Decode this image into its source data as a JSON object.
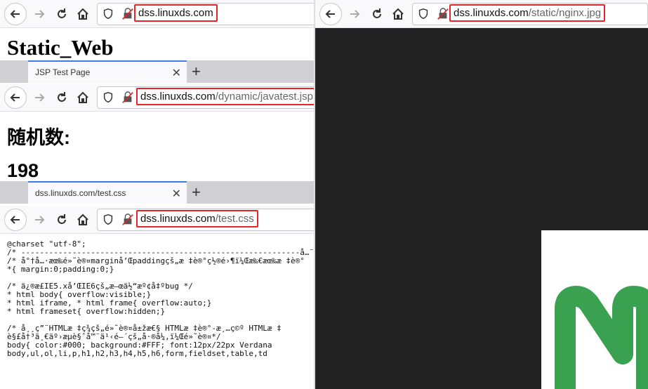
{
  "windows": {
    "static_html": {
      "url_host": "dss.linuxds.com",
      "url_path": "",
      "heading": "Static_Web"
    },
    "jsp": {
      "tab_title": "JSP Test Page",
      "url_host": "dss.linuxds.com",
      "url_path": "/dynamic/javatest.jsp",
      "label": "随机数:",
      "value": "198"
    },
    "css": {
      "tab_title": "dss.linuxds.com/test.css",
      "url_host": "dss.linuxds.com",
      "url_path": "/test.css",
      "lines": [
        "@charset \"utf-8\";",
        "/* ------------------------------------------------------------å…¨å±€é‡ç½®---------",
        "/* å°†å…·æœ‰é»˜è®¤marginå’Œpaddingçš„æ ‡è®°ç½®é›¶ï¼Œæ‰€æœ‰æ ‡è®°",
        "*{ margin:0;padding:0;}",
        "",
        "/* ä¿®æ­£IE5.xå’ŒIE6çš„æ–œä½“æº¢å‡ºbug */",
        "* html body{ overflow:visible;}",
        "* html iframe, * html frame{ overflow:auto;}",
        "* html frameset{ overflow:hidden;}",
        "",
        "/* å¸¸ç”¨HTMLæ ‡ç­¾çš„é»˜è®¤å±žæ€§ HTMLæ ‡è®°-æ¸…ç©º HTMLæ ‡",
        "è§£å†³ä¸€äº›æµè§ˆå™¨ä¹‹é—´çš„å·®å¼‚ï¼Œé»˜è®¤*/",
        "body{ color:#000; background:#FFF; font:12px/22px Verdana",
        "body,ul,ol,li,p,h1,h2,h3,h4,h5,h6,form,fieldset,table,td"
      ]
    },
    "image": {
      "url_host": "dss.linuxds.com",
      "url_path": "/static/nginx.jpg",
      "logo_color": "#3aa150",
      "viewer_bg": "#222222"
    }
  },
  "icons": [
    "back-arrow-icon",
    "forward-arrow-icon",
    "reload-icon",
    "home-icon",
    "shield-icon",
    "insecure-lock-icon",
    "close-icon",
    "plus-icon"
  ]
}
